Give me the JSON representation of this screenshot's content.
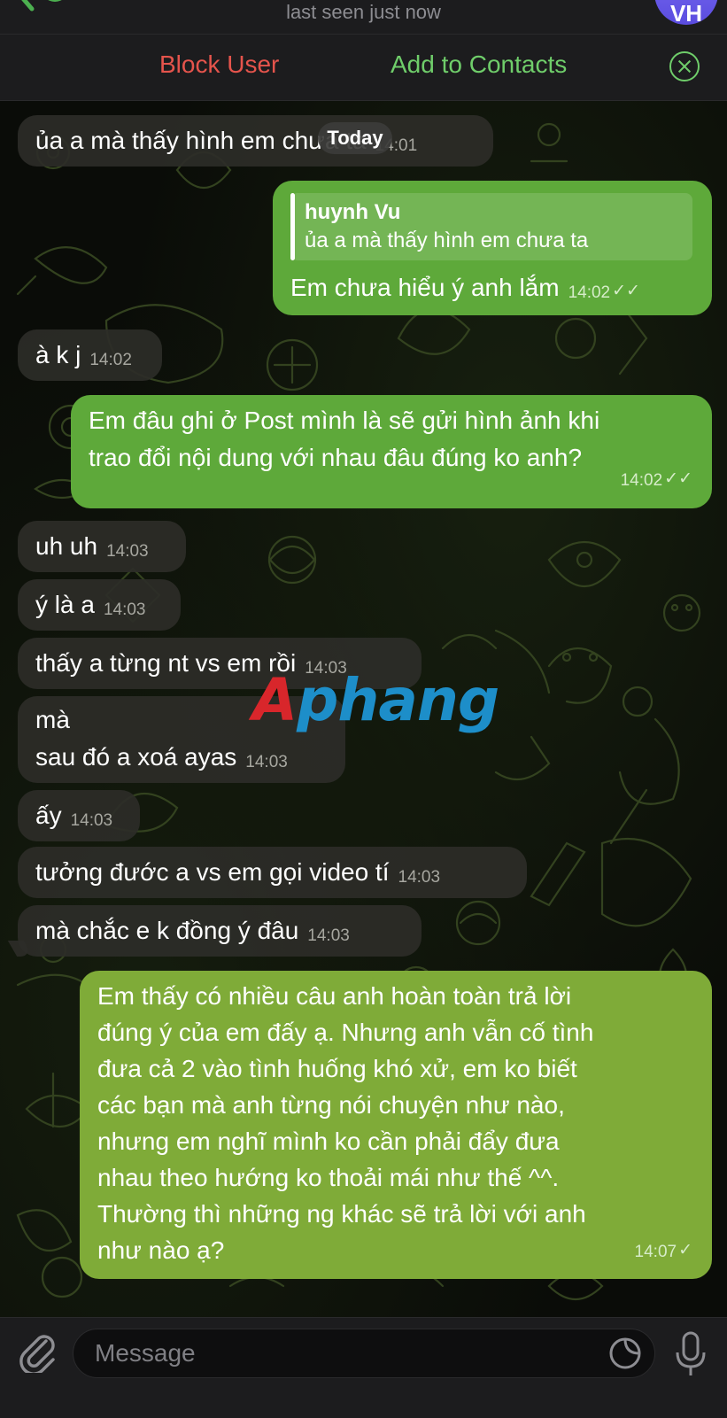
{
  "header": {
    "last_seen": "last seen just now",
    "avatar_initials": "VH",
    "block_user": "Block User",
    "add_to_contacts": "Add to Contacts"
  },
  "date_pill": "Today",
  "watermark": {
    "part_a": "A",
    "part_b": "phang"
  },
  "messages": [
    {
      "dir": "in",
      "text": "ủa a mà thấy hình em chưa ta",
      "time": "14:01"
    },
    {
      "dir": "out",
      "reply_name": "huynh Vu",
      "reply_text": "ủa a mà thấy hình em chưa ta",
      "text": "Em chưa hiểu ý anh lắm",
      "time": "14:02",
      "status": "✓✓"
    },
    {
      "dir": "in",
      "text": "à k j",
      "time": "14:02"
    },
    {
      "dir": "out",
      "line1": "Em đâu ghi ở Post mình là sẽ gửi hình ảnh khi",
      "line2": "trao đổi nội dung với nhau đâu đúng ko anh?",
      "time": "14:02",
      "status": "✓✓"
    },
    {
      "dir": "in",
      "text": "uh uh",
      "time": "14:03"
    },
    {
      "dir": "in",
      "text": "ý là a",
      "time": "14:03"
    },
    {
      "dir": "in",
      "text": "thấy a từng nt vs em rồi",
      "time": "14:03"
    },
    {
      "dir": "in",
      "line1": "mà",
      "line2": "sau đó a xoá ayas",
      "time": "14:03"
    },
    {
      "dir": "in",
      "text": "ấy",
      "time": "14:03"
    },
    {
      "dir": "in",
      "text": "tưởng đước a vs em gọi video tí",
      "time": "14:03"
    },
    {
      "dir": "in",
      "text": "mà chắc e k đồng ý đâu",
      "time": "14:03"
    },
    {
      "dir": "out",
      "lines": [
        "Em thấy có nhiều câu anh hoàn toàn trả lời",
        "đúng ý của em đấy ạ. Nhưng anh vẫn cố tình",
        "đưa cả 2 vào tình huống khó xử, em ko biết",
        "các bạn mà anh từng nói chuyện như nào,",
        "nhưng em nghĩ mình ko cần phải đẩy đưa",
        "nhau theo hướng ko thoải mái như thế ^^.",
        "Thường thì những ng khác sẽ trả lời với anh",
        "như nào ạ?"
      ],
      "time": "14:07",
      "status": "✓"
    }
  ],
  "composer": {
    "placeholder": "Message"
  },
  "colors": {
    "outgoing": "#5ea93a",
    "incoming": "#2c2c28",
    "accent_green": "#6fcd6a",
    "accent_red": "#e5544c"
  }
}
